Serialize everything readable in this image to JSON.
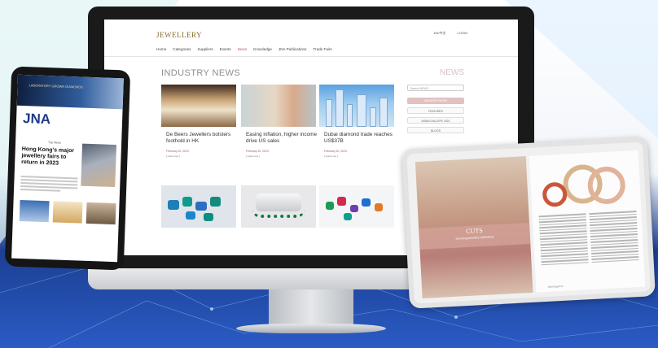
{
  "site": {
    "logo": "JEWELLERY",
    "header_right": [
      "EN/中文",
      "LOGIN"
    ],
    "nav": [
      "Home",
      "Categories",
      "Suppliers",
      "Events",
      "News",
      "Knowledge",
      "JNA Publications",
      "Trade Fairs"
    ],
    "nav_active": "News",
    "section_title": "INDUSTRY NEWS",
    "news_label": "NEWS",
    "sidebar": {
      "search_placeholder": "Search NEWS",
      "active": "INDUSTRY NEWS",
      "buttons": [
        "FEATURES",
        "ASIAN GALLERY 2021",
        "BLOGS"
      ]
    },
    "articles": [
      {
        "title": "De Beers Jewellers bolsters foothold in HK",
        "date": "February 20, 2023",
        "more": "[ read more ]"
      },
      {
        "title": "Easing inflation, higher income drive US sales",
        "date": "February 20, 2023",
        "more": "[ read more ]"
      },
      {
        "title": "Dubai diamond trade reaches US$37B",
        "date": "February 20, 2023",
        "more": "[ read more ]"
      }
    ]
  },
  "tablet_left": {
    "banner": "LABORATORY GROWN DIAMONDS",
    "logo": "JNA",
    "top_news_label": "Top News",
    "headline": "Hong Kong's major jewellery fairs to return in 2023"
  },
  "magazine": {
    "brand": "CUTS",
    "tagline": "Stunning jewellery collections",
    "footer": "JNA Magazine"
  }
}
